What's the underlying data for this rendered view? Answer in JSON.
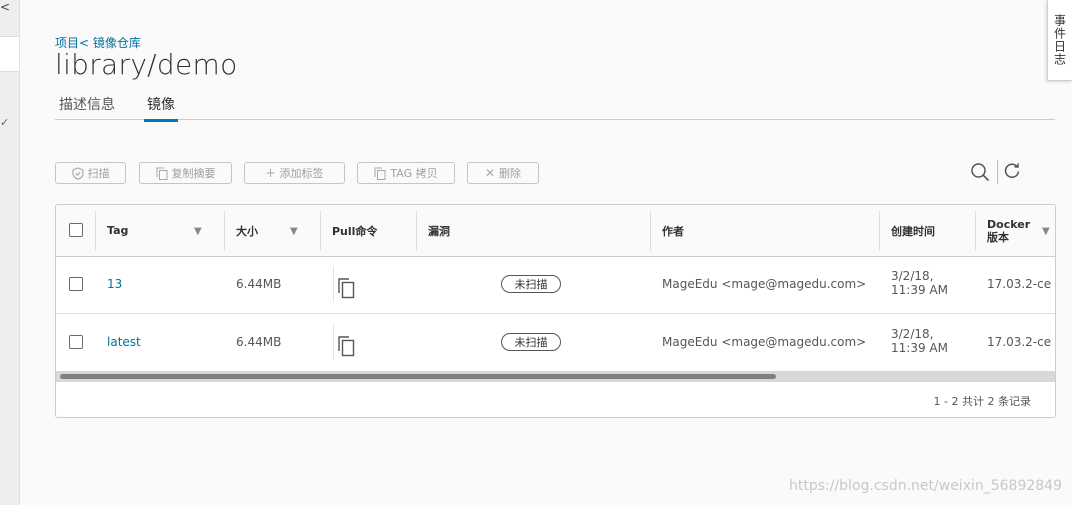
{
  "sidebar": {
    "collapse_glyph": "<",
    "check_glyph": "✓"
  },
  "event_log": {
    "label": "事件日志"
  },
  "breadcrumb": "项目< 镜像仓库",
  "title": "library/demo",
  "tabs": [
    {
      "label": "描述信息",
      "active": false
    },
    {
      "label": "镜像",
      "active": true
    }
  ],
  "toolbar": {
    "scan": "扫描",
    "copy_digest": "复制摘要",
    "add_label": "添加标签",
    "tag_copy": "TAG 拷贝",
    "delete": "删除"
  },
  "table": {
    "columns": {
      "tag": "Tag",
      "size": "大小",
      "pull": "Pull命令",
      "vuln": "漏洞",
      "author": "作者",
      "created": "创建时间",
      "docker_line1": "Docker",
      "docker_line2": "版本"
    },
    "rows": [
      {
        "tag": "13",
        "size": "6.44MB",
        "vuln": "未扫描",
        "author": "MageEdu <mage@magedu.com>",
        "created_date": "3/2/18,",
        "created_time": "11:39 AM",
        "docker": "17.03.2-ce"
      },
      {
        "tag": "latest",
        "size": "6.44MB",
        "vuln": "未扫描",
        "author": "MageEdu <mage@magedu.com>",
        "created_date": "3/2/18,",
        "created_time": "11:39 AM",
        "docker": "17.03.2-ce"
      }
    ],
    "footer": "1 - 2 共计 2 条记录"
  },
  "watermark": "https://blog.csdn.net/weixin_56892849",
  "colors": {
    "link": "#0072a3",
    "active_tab": "#0079b8"
  }
}
